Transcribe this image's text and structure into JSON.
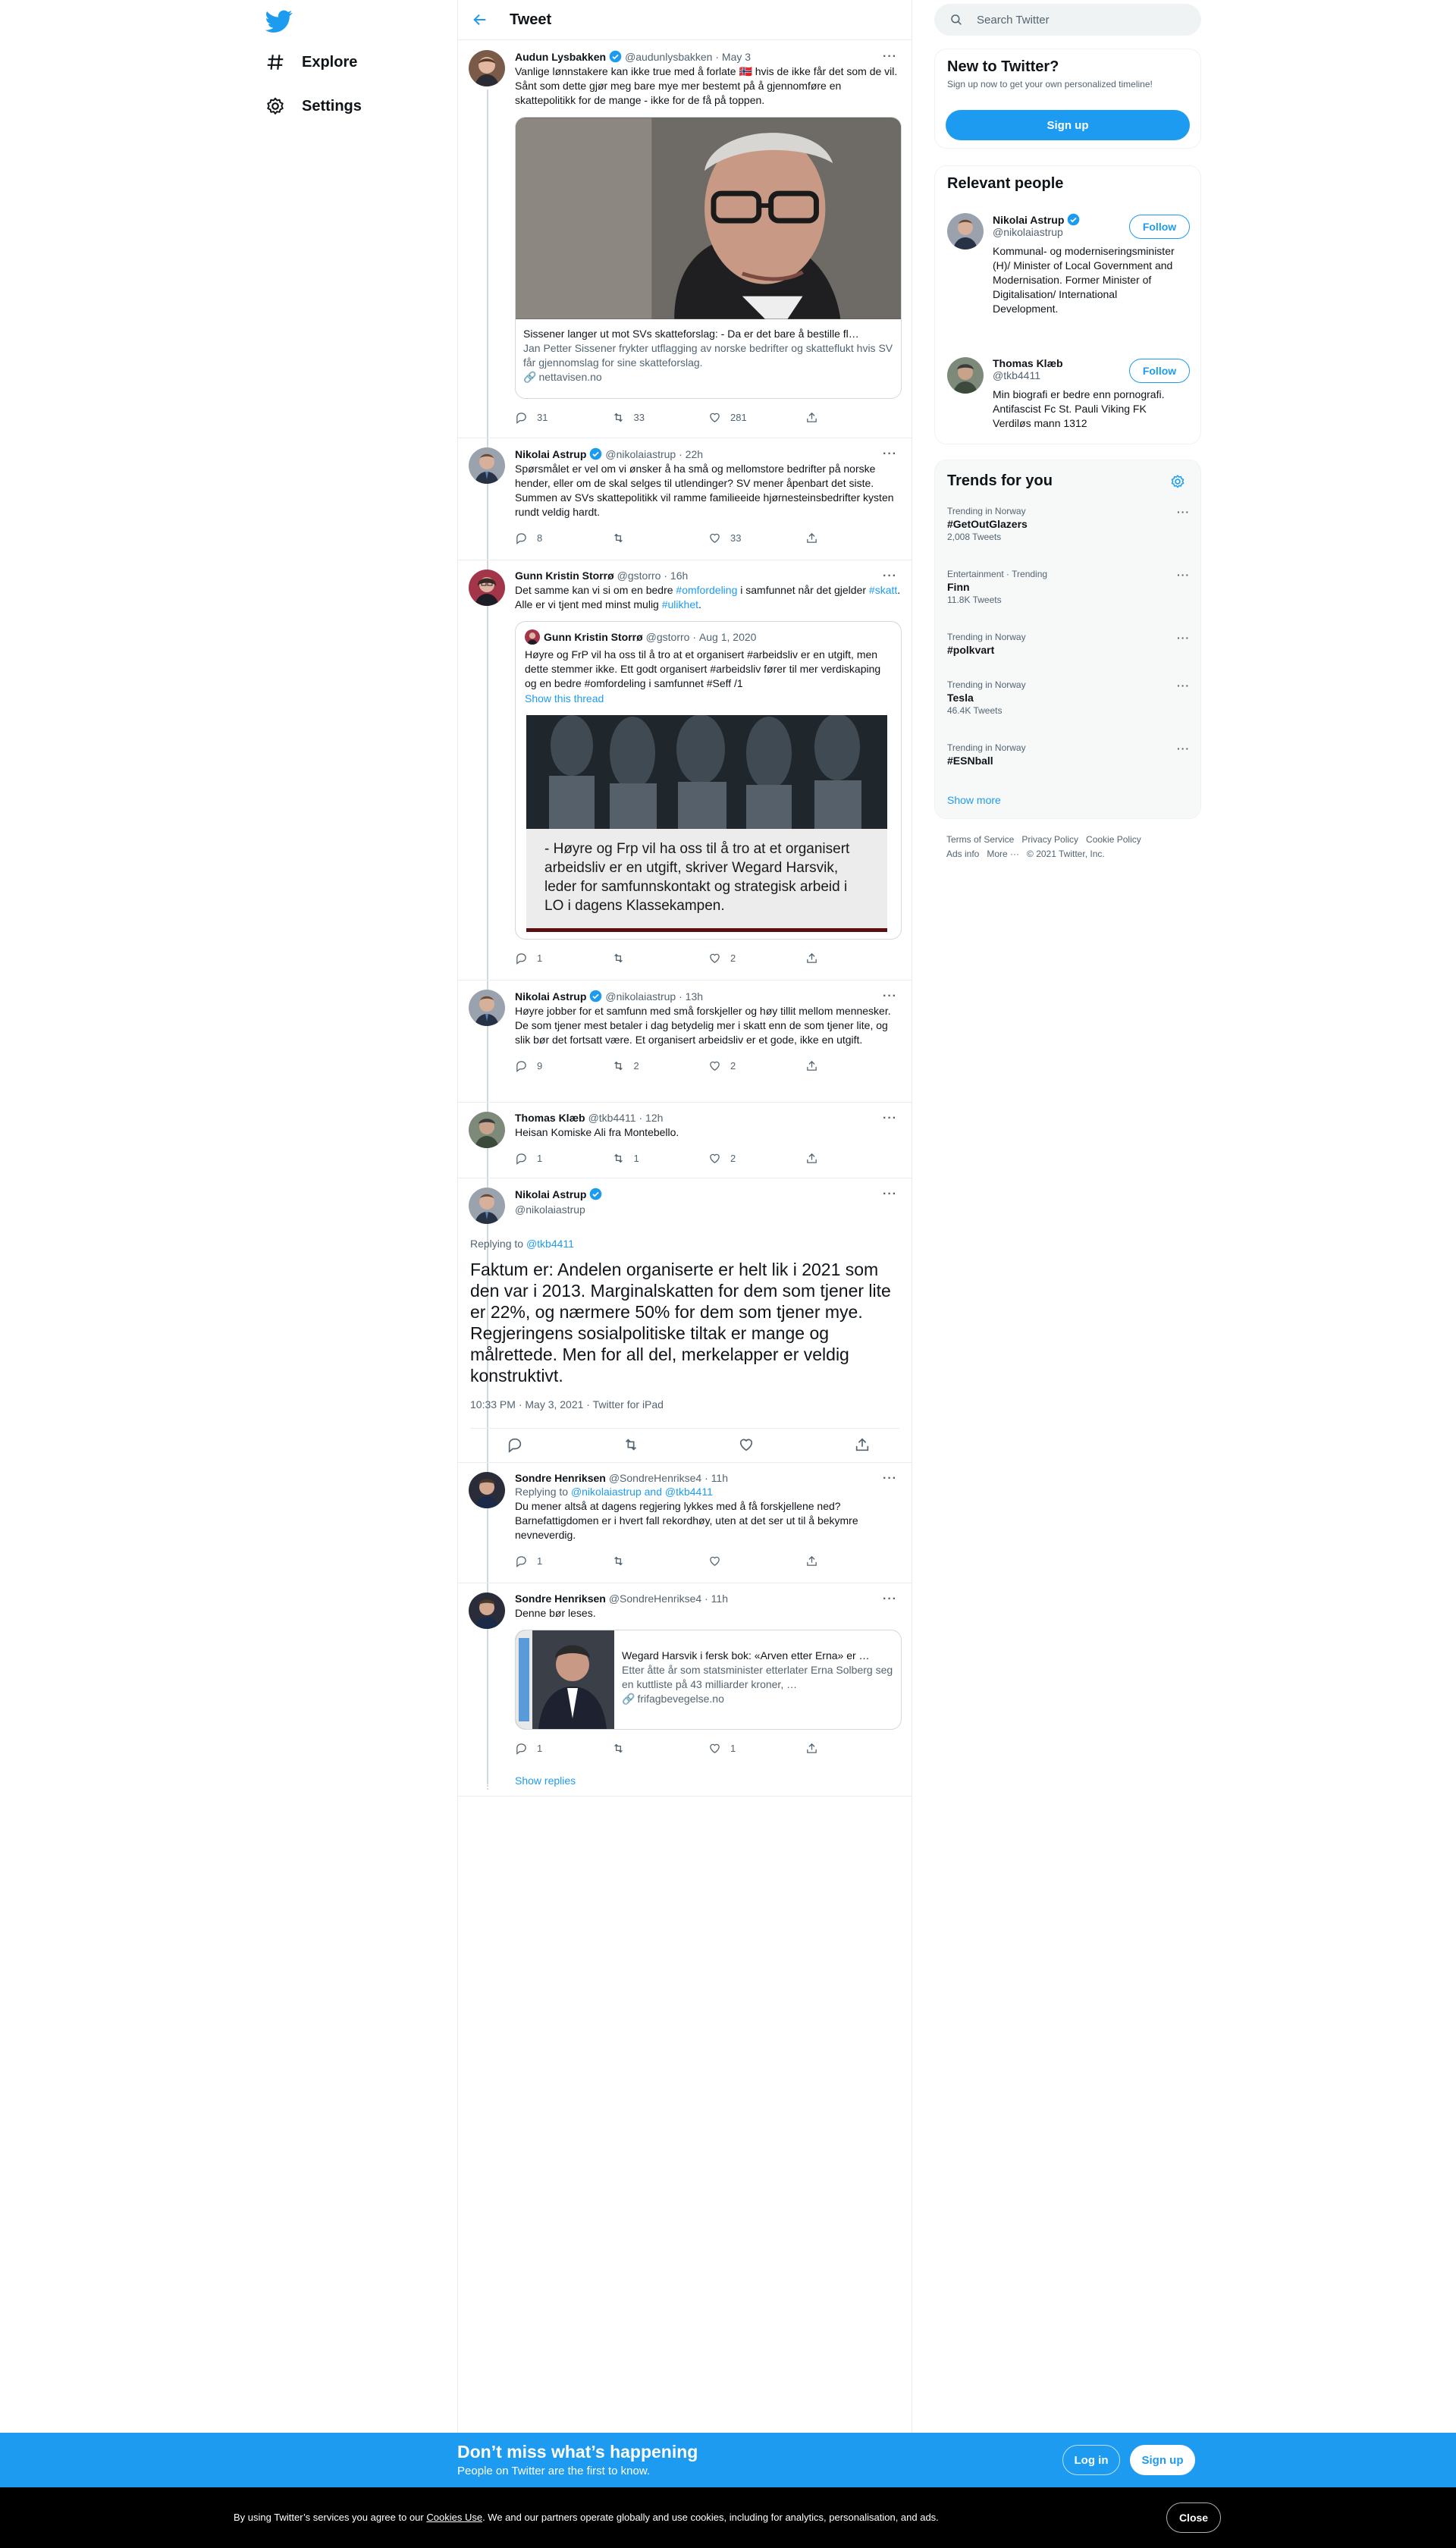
{
  "nav": {
    "explore": "Explore",
    "settings": "Settings"
  },
  "header": {
    "title": "Tweet"
  },
  "search": {
    "placeholder": "Search Twitter"
  },
  "tweets": [
    {
      "name": "Audun Lysbakken",
      "handle": "@audunlysbakken",
      "time": "May 3",
      "text": "Vanlige lønnstakere kan ikke true med å forlate 🇳🇴 hvis de ikke får det som de vil. Sånt som dette gjør meg bare mye mer bestemt på å gjennomføre en skattepolitikk for de mange - ikke for de få på toppen.",
      "card": {
        "title": "Sissener langer ut mot SVs skatteforslag: - Da er det bare å bestille fl…",
        "desc": "Jan Petter Sissener frykter utflagging av norske bedrifter og skatteflukt hvis SV får gjennomslag for sine skatteforslag.",
        "url": "nettavisen.no"
      },
      "replies": "31",
      "retweets": "33",
      "likes": "281"
    },
    {
      "name": "Nikolai Astrup",
      "handle": "@nikolaiastrup",
      "time": "22h",
      "text": "Spørsmålet er vel om vi ønsker å ha små og mellomstore bedrifter på norske hender, eller om de skal selges til utlendinger? SV mener åpenbart det siste. Summen av SVs skattepolitikk vil ramme familieeide hjørnesteinsbedrifter kysten rundt veldig hardt.",
      "replies": "8",
      "retweets": "",
      "likes": "33"
    },
    {
      "name": "Gunn Kristin Storrø",
      "handle": "@gstorro",
      "time": "16h",
      "text_a": "Det samme kan vi si om en bedre ",
      "tag1": "#omfordeling",
      "text_b": " i samfunnet når det gjelder ",
      "tag2": "#skatt",
      "text_c": ". Alle er vi tjent med minst mulig ",
      "tag3": "#ulikhet",
      "text_d": ".",
      "quote": {
        "name": "Gunn Kristin Storrø",
        "handle": "@gstorro",
        "time": "Aug 1, 2020",
        "text": "Høyre og FrP vil ha oss til å tro at et organisert #arbeidsliv er en utgift, men dette stemmer ikke. Ett godt organisert #arbeidsliv fører til mer verdiskaping og en bedre #omfordeling i samfunnet #Seff /1",
        "show_thread": "Show this thread",
        "image_caption": "- Høyre og Frp vil ha oss til å tro at et organisert arbeidsliv er en utgift, skriver Wegard Harsvik, leder for samfunnskontakt og strategisk arbeid i LO i dagens Klassekampen."
      },
      "replies": "1",
      "retweets": "",
      "likes": "2"
    },
    {
      "name": "Nikolai Astrup",
      "handle": "@nikolaiastrup",
      "time": "13h",
      "text": "Høyre jobber for et samfunn med små forskjeller og høy tillit mellom mennesker. De som tjener mest betaler i dag betydelig mer i skatt enn de som tjener lite, og slik bør det fortsatt være. Et organisert arbeidsliv er et gode, ikke en utgift.",
      "replies": "9",
      "retweets": "2",
      "likes": "2"
    },
    {
      "name": "Thomas Klæb",
      "handle": "@tkb4411",
      "time": "12h",
      "text": "Heisan Komiske Ali fra Montebello.",
      "replies": "1",
      "retweets": "1",
      "likes": "2"
    }
  ],
  "main_tweet": {
    "name": "Nikolai Astrup",
    "handle": "@nikolaiastrup",
    "replying_prefix": "Replying to ",
    "replying_to": "@tkb4411",
    "text": "Faktum er: Andelen organiserte er helt lik i 2021 som den var i 2013. Marginalskatten for dem som tjener lite er 22%, og nærmere 50% for dem som tjener mye. Regjeringens sosialpolitiske tiltak er mange og målrettede. Men for all del, merkelapper er veldig konstruktivt.",
    "timestamp": "10:33 PM · May 3, 2021 · Twitter for iPad"
  },
  "replies": [
    {
      "name": "Sondre Henriksen",
      "handle": "@SondreHenrikse4",
      "time": "11h",
      "replying_prefix": "Replying to ",
      "replying_to": "@nikolaiastrup and @tkb4411",
      "text": "Du mener altså at dagens regjering lykkes med å få forskjellene ned? Barnefattigdomen er i hvert fall rekordhøy, uten at det ser ut til å bekymre nevneverdig.",
      "replies": "1",
      "retweets": "",
      "likes": ""
    },
    {
      "name": "Sondre Henriksen",
      "handle": "@SondreHenrikse4",
      "time": "11h",
      "text": "Denne bør leses.",
      "card": {
        "title": "Wegard Harsvik i fersk bok: «Arven etter Erna» er …",
        "desc": "Etter åtte år som statsminister etterlater Erna Solberg seg en kuttliste på 43 milliarder kroner, …",
        "url": "frifagbevegelse.no"
      },
      "replies": "1",
      "retweets": "",
      "likes": "1"
    }
  ],
  "show_replies": "Show replies",
  "sidebar": {
    "new_title": "New to Twitter?",
    "new_sub": "Sign up now to get your own personalized timeline!",
    "signup": "Sign up",
    "relevant_title": "Relevant people",
    "people": [
      {
        "name": "Nikolai Astrup",
        "handle": "@nikolaiastrup",
        "bio": "Kommunal- og moderniseringsminister (H)/ Minister of Local Government and Modernisation. Former Minister of Digitalisation/ International Development.",
        "follow": "Follow"
      },
      {
        "name": "Thomas Klæb",
        "handle": "@tkb4411",
        "bio": "Min biografi er bedre enn pornografi. Antifascist Fc St. Pauli Viking FK Verdiløs mann 1312",
        "follow": "Follow"
      }
    ],
    "trends_title": "Trends for you",
    "trends": [
      {
        "context": "Trending in Norway",
        "name": "#GetOutGlazers",
        "count": "2,008 Tweets"
      },
      {
        "context": "Entertainment · Trending",
        "name": "Finn",
        "count": "11.8K Tweets"
      },
      {
        "context": "Trending in Norway",
        "name": "#polkvart",
        "count": ""
      },
      {
        "context": "Trending in Norway",
        "name": "Tesla",
        "count": "46.4K Tweets"
      },
      {
        "context": "Trending in Norway",
        "name": "#ESNball",
        "count": ""
      }
    ],
    "show_more": "Show more",
    "footer_line1": "Terms of Service   Privacy Policy   Cookie Policy",
    "footer_line2": "Ads info   More ···   © 2021 Twitter, Inc."
  },
  "banner": {
    "title": "Don’t miss what’s happening",
    "sub": "People on Twitter are the first to know.",
    "login": "Log in",
    "signup": "Sign up"
  },
  "cookie": {
    "text_a": "By using Twitter’s services you agree to our ",
    "link": "Cookies Use",
    "text_b": ". We and our partners operate globally and use cookies, including for analytics, personalisation, and ads.",
    "close": "Close"
  },
  "colors": {
    "accent": "#1d9bf0",
    "text": "#0f1419",
    "muted": "#536471",
    "border": "#e6ecf0"
  }
}
